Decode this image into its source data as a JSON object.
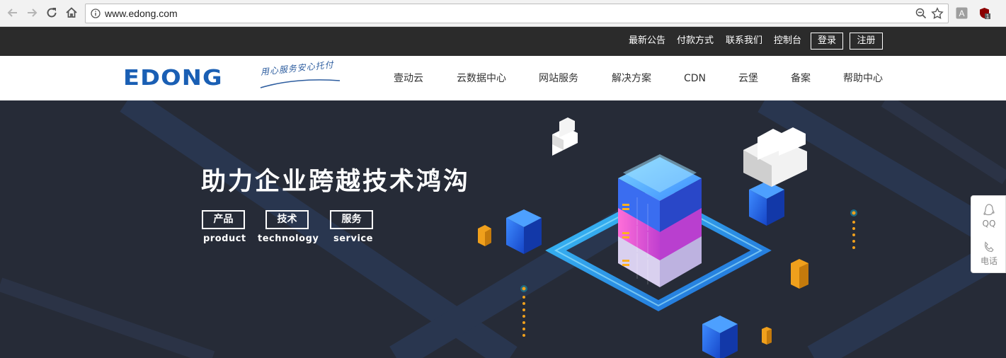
{
  "browser": {
    "url": "www.edong.com",
    "extensions": [
      {
        "name": "translate-extension",
        "label": "A"
      },
      {
        "name": "ublock-extension",
        "badge": "1"
      }
    ]
  },
  "topbar": {
    "links": [
      "最新公告",
      "付款方式",
      "联系我们",
      "控制台"
    ],
    "login_label": "登录",
    "register_label": "注册"
  },
  "header": {
    "logo_text": "EDONG",
    "slogan": "用心服务安心托付",
    "nav": [
      "壹动云",
      "云数据中心",
      "网站服务",
      "解决方案",
      "CDN",
      "云堡",
      "备案",
      "帮助中心"
    ]
  },
  "hero": {
    "title": "助力企业跨越技术鸿沟",
    "tags": [
      {
        "label": "产品",
        "sub": "product"
      },
      {
        "label": "技术",
        "sub": "technology"
      },
      {
        "label": "服务",
        "sub": "service"
      }
    ]
  },
  "float_panel": {
    "qq_label": "QQ",
    "phone_label": "电话"
  },
  "colors": {
    "topbar_bg": "#2b2b2b",
    "hero_bg": "#262b37",
    "brand_blue": "#1a5fb4"
  }
}
